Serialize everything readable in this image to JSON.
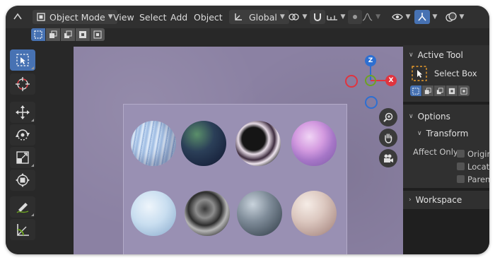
{
  "header": {
    "mode_label": "Object Mode",
    "menus": [
      "View",
      "Select",
      "Add",
      "Object"
    ],
    "orientation_label": "Global"
  },
  "toolbar": {
    "tools": [
      "select-box",
      "cursor",
      "move",
      "rotate",
      "scale",
      "transform",
      "annotate",
      "measure"
    ]
  },
  "gizmo": {
    "z_label": "Z",
    "x_label": "X"
  },
  "sidebar": {
    "active_tool_title": "Active Tool",
    "select_box_label": "Select Box",
    "options_title": "Options",
    "transform_title": "Transform",
    "affect_only_label": "Affect Only",
    "checkbox_labels": [
      "Origins",
      "Locations",
      "Parents"
    ],
    "workspace_title": "Workspace"
  },
  "colors": {
    "accent": "#4772b3",
    "axis_x": "#e0343f",
    "axis_y": "#6ca323",
    "axis_z": "#2d6fd1",
    "viewport_bg": "#8b81a3"
  }
}
